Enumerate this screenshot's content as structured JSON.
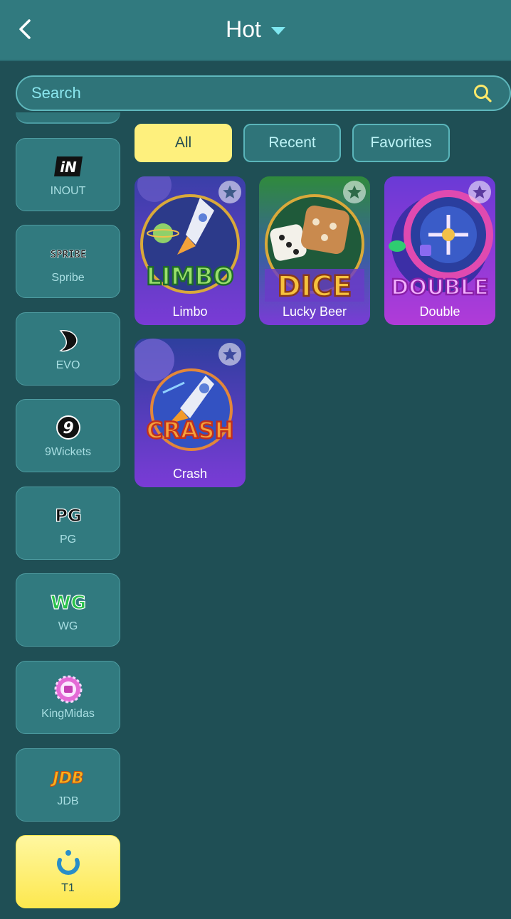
{
  "header": {
    "title": "Hot"
  },
  "search": {
    "placeholder": "Search"
  },
  "providers": [
    {
      "label": "INOUT",
      "logo_text": "iN"
    },
    {
      "label": "Spribe",
      "logo_text": "SPRIBE"
    },
    {
      "label": "EVO"
    },
    {
      "label": "9Wickets",
      "logo_text": "9"
    },
    {
      "label": "PG",
      "logo_text": "PG"
    },
    {
      "label": "WG",
      "logo_text": "WG"
    },
    {
      "label": "KingMidas"
    },
    {
      "label": "JDB",
      "logo_text": "JDB"
    },
    {
      "label": "T1",
      "active": true
    }
  ],
  "tabs": [
    {
      "label": "All",
      "active": true
    },
    {
      "label": "Recent"
    },
    {
      "label": "Favorites"
    }
  ],
  "games": [
    {
      "name": "Limbo",
      "art_text": "LIMBO"
    },
    {
      "name": "Lucky Beer",
      "art_text": "DICE"
    },
    {
      "name": "Double",
      "art_text": "DOUBLE"
    },
    {
      "name": "Crash",
      "art_text": "CRASH"
    }
  ],
  "colors": {
    "background": "#1f4f55",
    "header": "#317a7f",
    "active_yellow": "#fef07d",
    "accent_cyan": "#7fe7f0"
  }
}
